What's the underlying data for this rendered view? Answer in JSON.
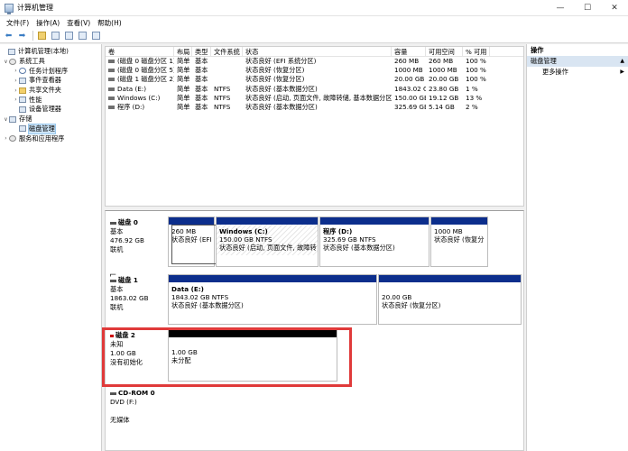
{
  "window": {
    "title": "计算机管理",
    "minimize": "—",
    "maximize": "☐",
    "close": "✕"
  },
  "menu": [
    "文件(F)",
    "操作(A)",
    "查看(V)",
    "帮助(H)"
  ],
  "toolbar": {
    "back": "⬅",
    "forward": "➡"
  },
  "tree": [
    {
      "label": "计算机管理(本地)",
      "arrow": "",
      "icon": "computer",
      "indent": 0
    },
    {
      "label": "系统工具",
      "arrow": "∨",
      "icon": "tools",
      "indent": 1
    },
    {
      "label": "任务计划程序",
      "arrow": "›",
      "icon": "clock",
      "indent": 2
    },
    {
      "label": "事件查看器",
      "arrow": "›",
      "icon": "log",
      "indent": 2
    },
    {
      "label": "共享文件夹",
      "arrow": "›",
      "icon": "folder",
      "indent": 2
    },
    {
      "label": "性能",
      "arrow": "›",
      "icon": "chart",
      "indent": 2
    },
    {
      "label": "设备管理器",
      "arrow": "",
      "icon": "device",
      "indent": 2
    },
    {
      "label": "存储",
      "arrow": "∨",
      "icon": "storage",
      "indent": 1
    },
    {
      "label": "磁盘管理",
      "arrow": "",
      "icon": "disk",
      "indent": 2,
      "selected": true
    },
    {
      "label": "服务和应用程序",
      "arrow": "›",
      "icon": "services",
      "indent": 1
    }
  ],
  "volumes": {
    "headers": [
      "卷",
      "布局",
      "类型",
      "文件系统",
      "状态",
      "容量",
      "可用空间",
      "% 可用"
    ],
    "rows": [
      [
        "(磁盘 0 磁盘分区 1)",
        "简单",
        "基本",
        "",
        "状态良好 (EFI 系统分区)",
        "260 MB",
        "260 MB",
        "100 %"
      ],
      [
        "(磁盘 0 磁盘分区 5)",
        "简单",
        "基本",
        "",
        "状态良好 (恢复分区)",
        "1000 MB",
        "1000 MB",
        "100 %"
      ],
      [
        "(磁盘 1 磁盘分区 2)",
        "简单",
        "基本",
        "",
        "状态良好 (恢复分区)",
        "20.00 GB",
        "20.00 GB",
        "100 %"
      ],
      [
        "Data (E:)",
        "简单",
        "基本",
        "NTFS",
        "状态良好 (基本数据分区)",
        "1843.02 GB",
        "23.80 GB",
        "1 %"
      ],
      [
        "Windows (C:)",
        "简单",
        "基本",
        "NTFS",
        "状态良好 (启动, 页面文件, 故障转储, 基本数据分区)",
        "150.00 GB",
        "19.12 GB",
        "13 %"
      ],
      [
        "程序 (D:)",
        "简单",
        "基本",
        "NTFS",
        "状态良好 (基本数据分区)",
        "325.69 GB",
        "5.14 GB",
        "2 %"
      ]
    ]
  },
  "disks": [
    {
      "name": "磁盘 0",
      "type": "基本",
      "size": "476.92 GB",
      "status": "联机",
      "partitions": [
        {
          "name": "",
          "size": "260 MB",
          "status": "状态良好 (EFI"
        },
        {
          "name": "Windows  (C:)",
          "size": "150.00 GB NTFS",
          "status": "状态良好 (启动, 页面文件, 故障转"
        },
        {
          "name": "程序  (D:)",
          "size": "325.69 GB NTFS",
          "status": "状态良好 (基本数据分区)"
        },
        {
          "name": "",
          "size": "1000 MB",
          "status": "状态良好 (恢复分"
        }
      ]
    },
    {
      "name": "磁盘 1",
      "type": "基本",
      "size": "1863.02 GB",
      "status": "联机",
      "partitions": [
        {
          "name": "Data  (E:)",
          "size": "1843.02 GB NTFS",
          "status": "状态良好 (基本数据分区)"
        },
        {
          "name": "",
          "size": "20.00 GB",
          "status": "状态良好 (恢复分区)"
        }
      ]
    },
    {
      "name": "磁盘 2",
      "type": "未知",
      "size": "1.00 GB",
      "status": "没有初始化",
      "partitions": [
        {
          "name": "",
          "size": "1.00 GB",
          "status": "未分配"
        }
      ]
    },
    {
      "name": "CD-ROM 0",
      "type": "DVD (F:)",
      "size": "",
      "status": "无媒体"
    }
  ],
  "actions": {
    "title": "操作",
    "section": "磁盘管理",
    "more": "更多操作"
  },
  "colors": {
    "primary_partition": "#0c2e8c",
    "unallocated": "#000000",
    "highlight": "#e03a3a",
    "selection": "#cce4f7"
  }
}
